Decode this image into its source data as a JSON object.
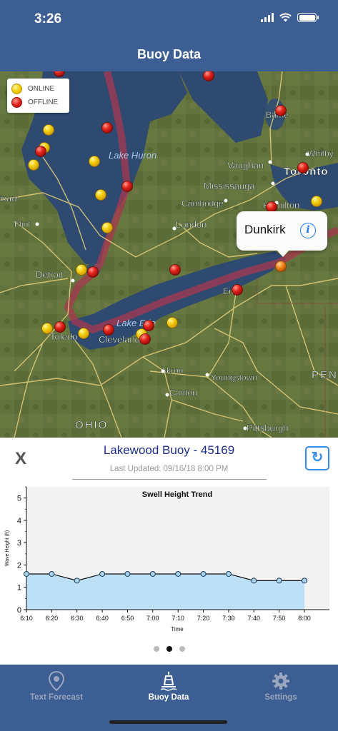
{
  "status_bar": {
    "time": "3:26",
    "icons": [
      "signal-icon",
      "wifi-icon",
      "battery-icon"
    ]
  },
  "nav": {
    "title": "Buoy Data"
  },
  "map": {
    "legend": {
      "online_label": "ONLINE",
      "offline_label": "OFFLINE"
    },
    "callout": {
      "title": "Dunkirk",
      "icon": "info-icon"
    },
    "lake_labels": [
      "Lake Huron",
      "Lake Erie"
    ],
    "city_labels": [
      "Barrie",
      "Whitby",
      "Vaughan",
      "Toronto",
      "Mississauga",
      "Cambridge",
      "Hamilton",
      "London",
      "Flint",
      "Saginaw",
      "Detroit",
      "Toledo",
      "Cleveland",
      "Erie",
      "Akron",
      "Youngstown",
      "Canton",
      "Pittsburgh",
      "OHIO",
      "PENNSYLVANIA"
    ],
    "colors": {
      "online": "#f5d214",
      "offline": "#e3241b",
      "selected": "#f28a1c"
    }
  },
  "panel": {
    "close_label": "X",
    "buoy_title": "Lakewood Buoy - 45169",
    "last_updated": "Last Updated: 09/16/18 8:00 PM",
    "refresh_icon": "refresh-icon"
  },
  "chart_data": {
    "type": "area",
    "title": "Swell Height Trend",
    "xlabel": "Time",
    "ylabel": "Wave Height (ft)",
    "categories": [
      "6:10",
      "6:20",
      "6:30",
      "6:40",
      "6:50",
      "7:00",
      "7:10",
      "7:20",
      "7:30",
      "7:40",
      "7:50",
      "8:00"
    ],
    "values": [
      1.6,
      1.6,
      1.3,
      1.6,
      1.6,
      1.6,
      1.6,
      1.6,
      1.6,
      1.3,
      1.3,
      1.3
    ],
    "ylim": [
      0,
      5.5
    ],
    "yticks": [
      0,
      1,
      2,
      3,
      4,
      5
    ],
    "grid": false,
    "colors": {
      "fill": "#bde0f6",
      "line": "#111111",
      "marker": "#a9d4f0",
      "background": "#f2f2f2"
    }
  },
  "pager": {
    "count": 3,
    "active_index": 1
  },
  "tabbar": {
    "tabs": [
      {
        "label": "Text Forecast",
        "icon": "location-pin-icon",
        "active": false
      },
      {
        "label": "Buoy Data",
        "icon": "buoy-icon",
        "active": true
      },
      {
        "label": "Settings",
        "icon": "gear-icon",
        "active": false
      }
    ]
  }
}
